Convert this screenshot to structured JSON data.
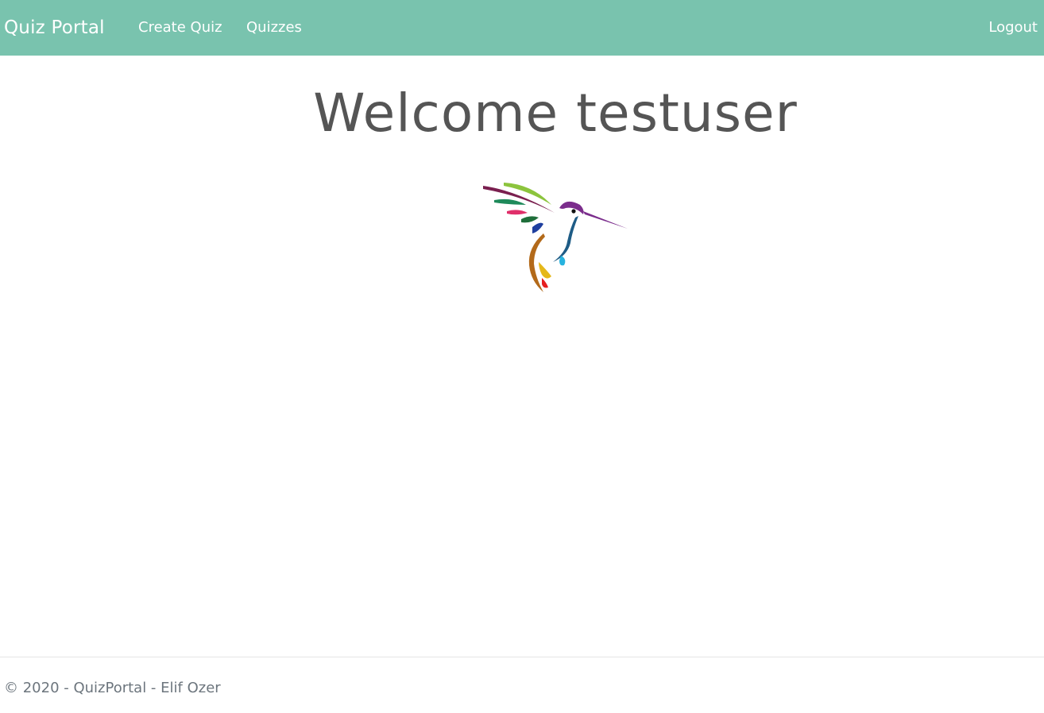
{
  "navbar": {
    "brand": "Quiz Portal",
    "links": [
      {
        "label": "Create Quiz"
      },
      {
        "label": "Quizzes"
      }
    ],
    "logout": "Logout",
    "background_color": "#79c3ae"
  },
  "main": {
    "welcome": "Welcome testuser",
    "logo_icon": "hummingbird-logo"
  },
  "footer": {
    "text": "© 2020 - QuizPortal - Elif Ozer"
  }
}
